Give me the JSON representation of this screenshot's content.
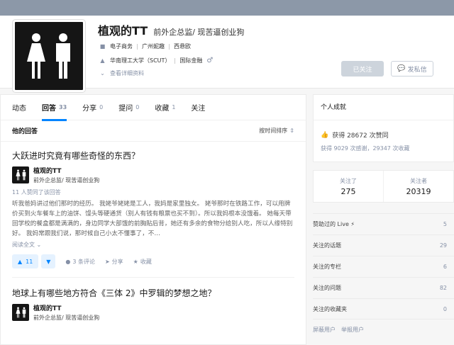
{
  "profile": {
    "name": "植观的TT",
    "headline": "前外企总监/ 现苦逼创业狗",
    "industry": "电子商务",
    "location": "广州妮趣",
    "position": "西悬欧",
    "school": "华南理工大学（SCUT）",
    "major": "国际金融",
    "gender_symbol": "♂",
    "more_info": "查看详细资料",
    "follow_button": "已关注",
    "message_button": "发私信"
  },
  "tabs": [
    {
      "label": "动态",
      "count": ""
    },
    {
      "label": "回答",
      "count": "33"
    },
    {
      "label": "分享",
      "count": "0"
    },
    {
      "label": "提问",
      "count": "0"
    },
    {
      "label": "收藏",
      "count": "1"
    },
    {
      "label": "关注",
      "count": ""
    }
  ],
  "list": {
    "title": "他的回答",
    "sort": "按时间排序"
  },
  "answers": [
    {
      "question": "大跃进时究竟有哪些奇怪的东西？",
      "author": "植观的TT",
      "author_headline": "前外企总监/ 现苦逼创业狗",
      "votes_info": "11 人赞同了该回答",
      "excerpt": "听我爸妈讲过他们那时的经历。 我姥爷姥姥是工人，我妈是家里独女。 姥爷那时在铁路工作，可以用牌价买到火车餐车上的油饼、馒头等硬通货（别人有钱有粮票也买不到）。所以我妈根本没饿着。 她每天带回学校的餐盒都是满满的，身边同学大部饿的前胸贴后背，她还有多余的食物分给别人吃，所以人缘特别好。 我妈常跟我们说，那时候自己小太不懂事了，不…",
      "read_more": "阅读全文",
      "vote_count": "11",
      "comments": "3 条评论",
      "share": "分享",
      "collect": "收藏"
    },
    {
      "question": "地球上有哪些地方符合《三体 2》中罗辑的梦想之地？",
      "author": "植观的TT",
      "author_headline": "前外企总监/ 现苦逼创业狗"
    }
  ],
  "achievements": {
    "title": "个人成就",
    "likes": "获得 28672 次赞同",
    "sub": "获得 9029 次感谢，29347 次收藏"
  },
  "follow_stats": {
    "following_label": "关注了",
    "following": "275",
    "followers_label": "关注者",
    "followers": "20319"
  },
  "side_links": [
    {
      "label": "赞助过的 Live ⚡",
      "count": "5"
    },
    {
      "label": "关注的话题",
      "count": "29"
    },
    {
      "label": "关注的专栏",
      "count": "6"
    },
    {
      "label": "关注的问题",
      "count": "82"
    },
    {
      "label": "关注的收藏夹",
      "count": "0"
    }
  ],
  "footer": {
    "block": "屏蔽用户",
    "report": "举报用户"
  },
  "colors": {
    "accent": "#0084ff",
    "muted": "#8590a6",
    "cover": "#8c98a8"
  }
}
